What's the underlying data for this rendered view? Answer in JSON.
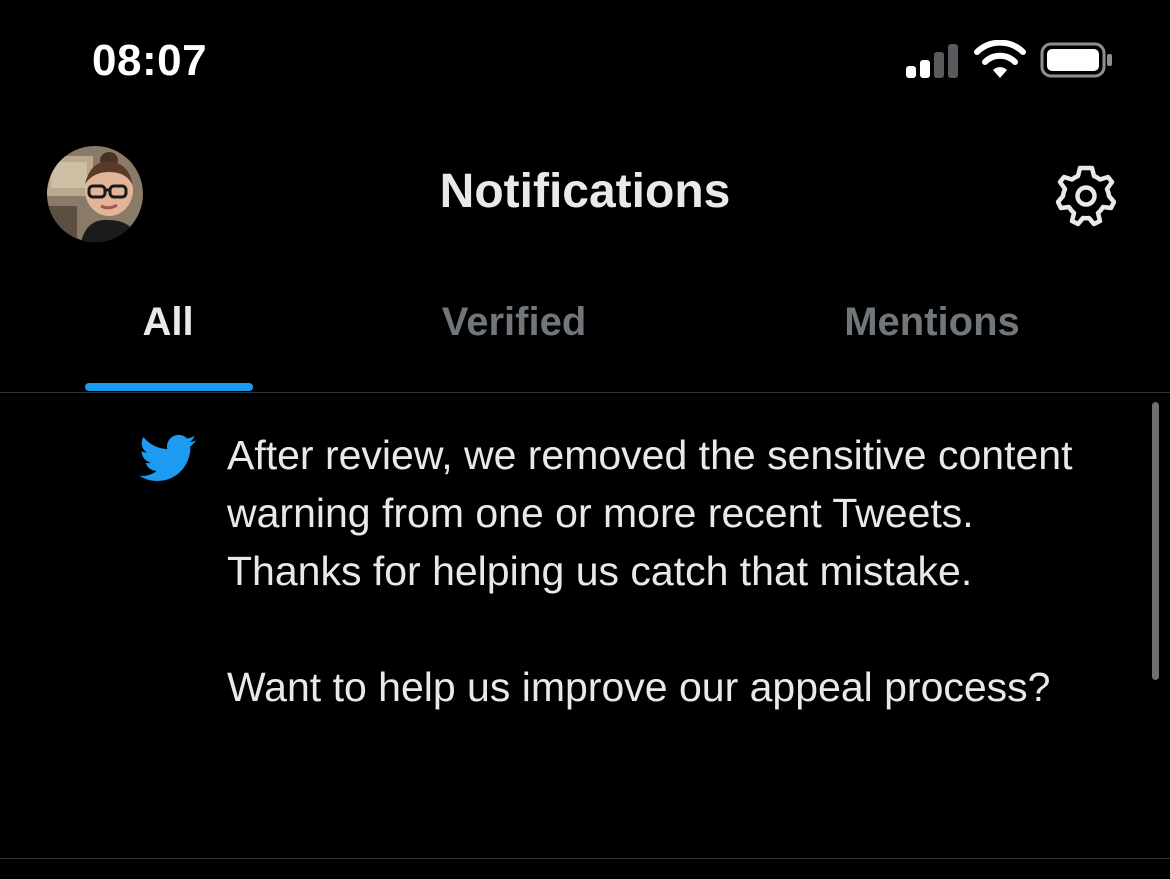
{
  "status_bar": {
    "time": "08:07",
    "signal_icon": "cellular-signal-icon",
    "wifi_icon": "wifi-icon",
    "battery_icon": "battery-icon"
  },
  "header": {
    "title": "Notifications",
    "avatar_icon": "profile-avatar",
    "settings_icon": "gear-icon"
  },
  "tabs": [
    {
      "label": "All",
      "active": true
    },
    {
      "label": "Verified",
      "active": false
    },
    {
      "label": "Mentions",
      "active": false
    }
  ],
  "notification": {
    "icon": "twitter-bird-icon",
    "paragraphs": [
      "After review, we removed the sensitive content warning from one or more recent Tweets. Thanks for helping us catch that mistake.",
      "Want to help us improve our appeal process?"
    ]
  },
  "colors": {
    "background": "#000000",
    "text_primary": "#e7e9ea",
    "text_secondary": "#71767b",
    "accent": "#1d9bf0",
    "divider": "#2f3336"
  }
}
